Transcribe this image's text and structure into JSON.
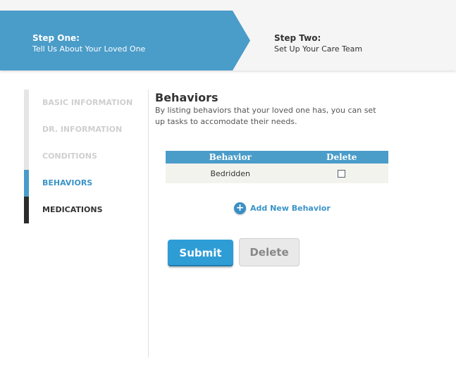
{
  "wizard": {
    "step1": {
      "title": "Step One:",
      "subtitle": "Tell Us About Your Loved One"
    },
    "step2": {
      "title": "Step Two:",
      "subtitle": "Set Up Your Care Team"
    }
  },
  "sidebar": {
    "items": [
      {
        "label": "BASIC INFORMATION",
        "state": "completed"
      },
      {
        "label": "DR. INFORMATION",
        "state": "completed"
      },
      {
        "label": "CONDITIONS",
        "state": "completed"
      },
      {
        "label": "BEHAVIORS",
        "state": "active"
      },
      {
        "label": "MEDICATIONS",
        "state": "upcoming"
      }
    ]
  },
  "main": {
    "title": "Behaviors",
    "description": "By listing behaviors that your loved one has, you can set up tasks to accomodate their needs.",
    "table": {
      "headers": [
        "Behavior",
        "Delete"
      ],
      "rows": [
        {
          "behavior": "Bedridden",
          "delete_checked": false
        }
      ]
    },
    "add_label": "Add New Behavior",
    "submit_label": "Submit",
    "delete_label": "Delete"
  },
  "colors": {
    "accent": "#4a9cc9",
    "submit": "#2e9dd6",
    "link": "#3a94c9"
  }
}
